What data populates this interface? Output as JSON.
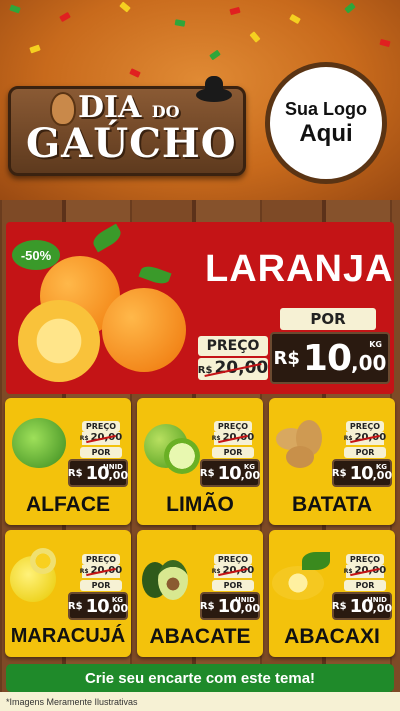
{
  "header": {
    "title_line1": "DIA",
    "title_do": "DO",
    "title_line2": "GAÚCHO",
    "logo_line1": "Sua Logo",
    "logo_line2": "Aqui"
  },
  "featured": {
    "discount": "-50%",
    "name": "LARANJA",
    "label_preco": "PREÇO",
    "label_por": "POR",
    "old_currency": "R$",
    "old_price": "20,00",
    "currency": "R$",
    "price_int": "10",
    "price_dec": ",00",
    "unit": "KG"
  },
  "products": [
    {
      "name": "ALFACE",
      "label_preco": "PREÇO",
      "label_por": "POR",
      "old_currency": "R$",
      "old_price": "20,00",
      "currency": "R$",
      "price_int": "10",
      "price_dec": ",00",
      "unit": "UNID"
    },
    {
      "name": "LIMÃO",
      "label_preco": "PREÇO",
      "label_por": "POR",
      "old_currency": "R$",
      "old_price": "20,00",
      "currency": "R$",
      "price_int": "10",
      "price_dec": ",00",
      "unit": "KG"
    },
    {
      "name": "BATATA",
      "label_preco": "PREÇO",
      "label_por": "POR",
      "old_currency": "R$",
      "old_price": "20,00",
      "currency": "R$",
      "price_int": "10",
      "price_dec": ",00",
      "unit": "KG"
    },
    {
      "name": "MARACUJÁ",
      "label_preco": "PREÇO",
      "label_por": "POR",
      "old_currency": "R$",
      "old_price": "20,00",
      "currency": "R$",
      "price_int": "10",
      "price_dec": ",00",
      "unit": "KG"
    },
    {
      "name": "ABACATE",
      "label_preco": "PREÇO",
      "label_por": "POR",
      "old_currency": "R$",
      "old_price": "20,00",
      "currency": "R$",
      "price_int": "10",
      "price_dec": ",00",
      "unit": "UNID"
    },
    {
      "name": "ABACAXI",
      "label_preco": "PREÇO",
      "label_por": "POR",
      "old_currency": "R$",
      "old_price": "20,00",
      "currency": "R$",
      "price_int": "10",
      "price_dec": ",00",
      "unit": "UNID"
    }
  ],
  "cta": "Crie seu encarte com este tema!",
  "footnote": "*Imagens Meramente Ilustrativas",
  "colors": {
    "hero_red": "#c41416",
    "card_yellow": "#f3c20c",
    "cta_green": "#1f8a2a",
    "wood": "#7e4a26"
  }
}
